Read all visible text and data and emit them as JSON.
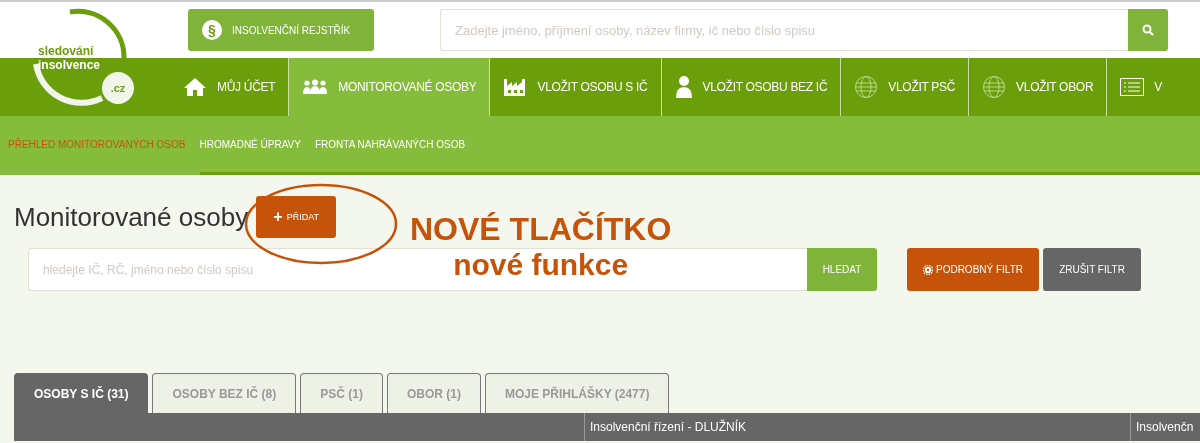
{
  "logo": {
    "line_1": "sledování",
    "line_2": "insolvence",
    "domain": ".cz"
  },
  "registry_button": {
    "icon": "§",
    "label": "INSOLVENČNÍ REJSTŘÍK"
  },
  "global_search": {
    "placeholder": "Zadejte jméno, příjmení osoby, název firmy, ič nebo číslo spisu"
  },
  "nav": [
    {
      "label": "MŮJ ÚČET",
      "selected": false
    },
    {
      "label": "MONITOROVANÉ OSOBY",
      "selected": true
    },
    {
      "label": "VLOŽIT OSOBU S IČ",
      "selected": false
    },
    {
      "label": "VLOŽIT OSOBU BEZ IČ",
      "selected": false
    },
    {
      "label": "VLOŽIT PSČ",
      "selected": false
    },
    {
      "label": "VLOŽIT OBOR",
      "selected": false
    },
    {
      "label": "V",
      "selected": false
    }
  ],
  "subnav": [
    {
      "label": "PŘEHLED MONITOROVANÝCH OSOB",
      "selected": true
    },
    {
      "label": "HROMADNÉ ÚPRAVY",
      "selected": false
    },
    {
      "label": "FRONTA NAHRÁVANÝCH OSOB",
      "selected": false
    }
  ],
  "page_title": "Monitorované osoby",
  "add_button": {
    "icon": "+",
    "label": "PŘIDAT"
  },
  "annotation": {
    "title": "NOVÉ TLAČÍTKO",
    "subtitle": "nové funkce"
  },
  "search": {
    "placeholder": "hledejte IČ, RČ, jméno nebo číslo spisu",
    "button": "HLEDAT"
  },
  "filter_buttons": [
    {
      "kind": "detail",
      "label": "PODROBNÝ FILTR"
    },
    {
      "kind": "clear",
      "label": "ZRUŠIT FILTR"
    }
  ],
  "tabs": [
    {
      "label": "OSOBY S IČ (31)",
      "selected": true
    },
    {
      "label": "OSOBY BEZ IČ (8)",
      "selected": false
    },
    {
      "label": "PSČ (1)",
      "selected": false
    },
    {
      "label": "OBOR (1)",
      "selected": false
    },
    {
      "label": "MOJE PŘIHLÁŠKY (2477)",
      "selected": false
    }
  ],
  "table": {
    "columns": [
      "Insolvenční řízení - DLUŽNÍK",
      "Insolvenčn"
    ]
  }
}
